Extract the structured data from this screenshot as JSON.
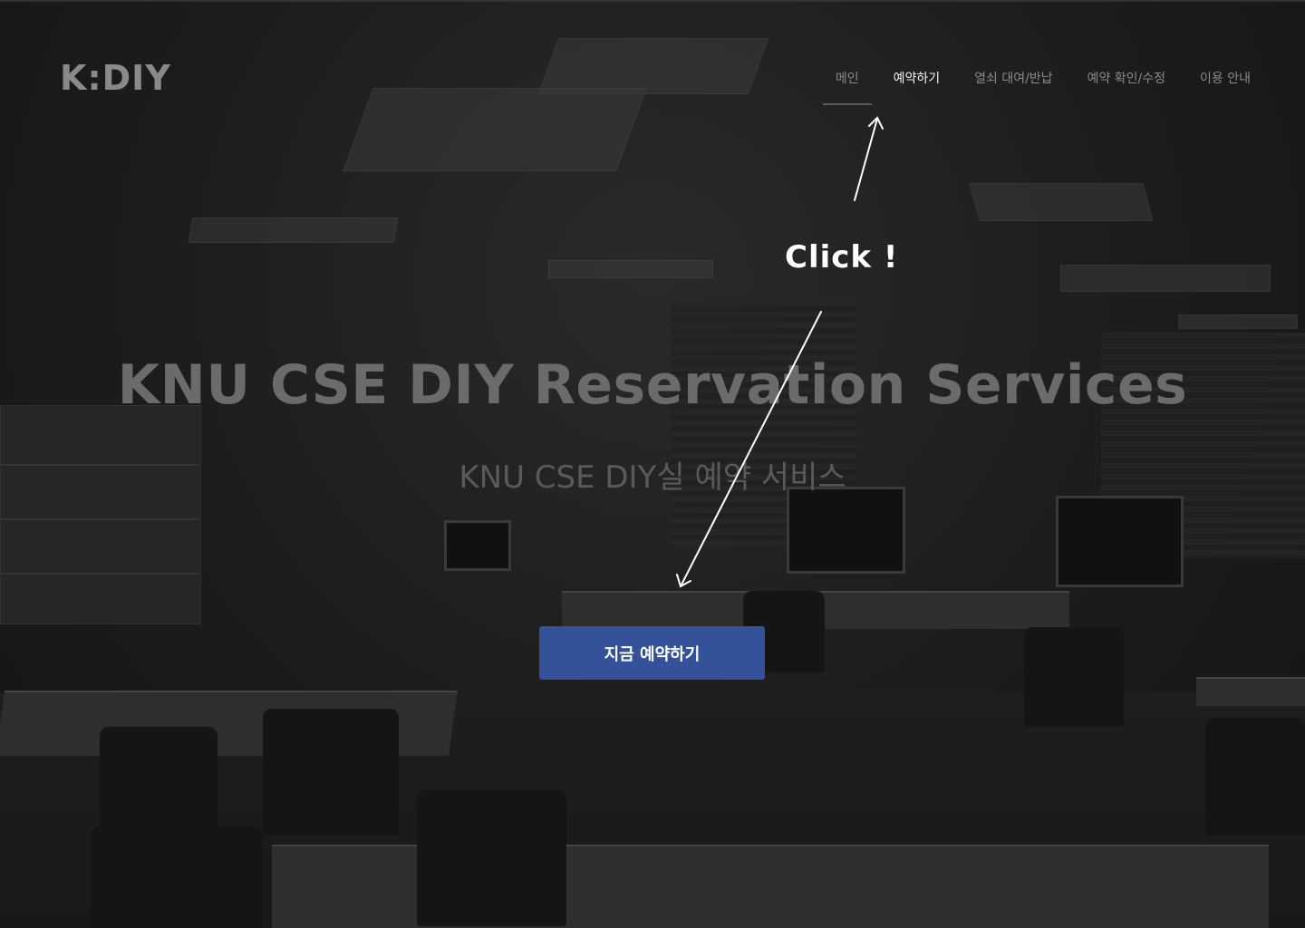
{
  "logo": "K:DIY",
  "nav": {
    "items": [
      {
        "label": "메인"
      },
      {
        "label": "예약하기"
      },
      {
        "label": "열쇠 대여/반납"
      },
      {
        "label": "예약 확인/수정"
      },
      {
        "label": "이용 안내"
      }
    ]
  },
  "hero": {
    "title": "KNU CSE DIY Reservation Services",
    "subtitle": "KNU CSE DIY실 예약 서비스",
    "cta_label": "지금 예약하기"
  },
  "annotation": {
    "text": "Click !"
  },
  "colors": {
    "cta_background": "#34529a",
    "nav_highlight": "#f2f2f2",
    "nav_default": "#8a8a8a"
  }
}
